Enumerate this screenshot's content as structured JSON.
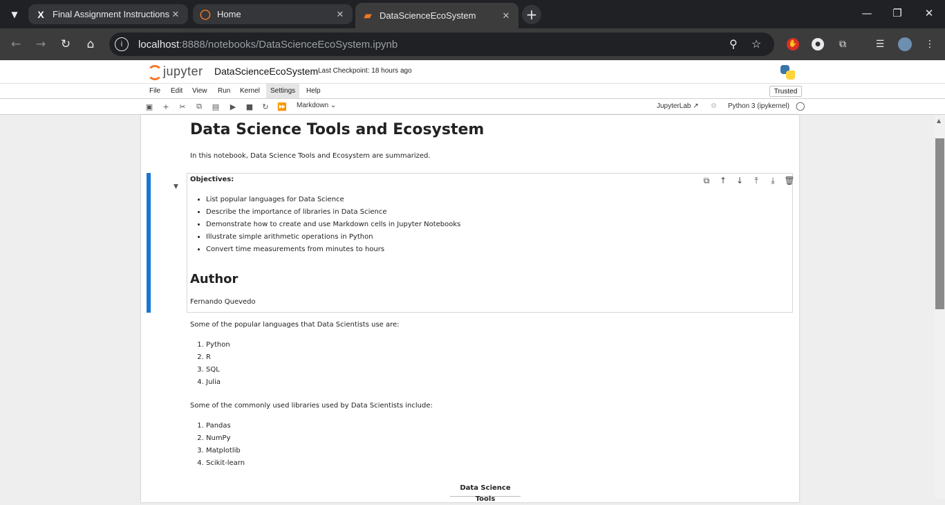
{
  "browser": {
    "tabs": [
      {
        "label": "Final Assignment Instructions: C",
        "icon": "x-logo-icon"
      },
      {
        "label": "Home",
        "icon": "jupyter-icon"
      },
      {
        "label": "DataScienceEcoSystem",
        "icon": "notebook-icon"
      }
    ],
    "url_host": "localhost",
    "url_rest": ":8888/notebooks/DataScienceEcoSystem.ipynb"
  },
  "jupyter": {
    "logo_text": "jupyter",
    "notebook_name": "DataScienceEcoSystem",
    "checkpoint": "Last Checkpoint: 18 hours ago",
    "menu": [
      "File",
      "Edit",
      "View",
      "Run",
      "Kernel",
      "Settings",
      "Help"
    ],
    "trusted": "Trusted",
    "cell_type": "Markdown",
    "jupyterlab_link": "JupyterLab",
    "kernel_name": "Python 3 (ipykernel)"
  },
  "notebook": {
    "title": "Data Science Tools and Ecosystem",
    "intro": "In this notebook, Data Science Tools and Ecosystem are summarized.",
    "objectives_heading": "Objectives:",
    "objectives": [
      "List popular languages for Data Science",
      "Describe the importance of libraries in Data Science",
      "Demonstrate how to create and use Markdown cells in Jupyter Notebooks",
      "Illustrate simple arithmetic operations in Python",
      "Convert time measurements from minutes to hours"
    ],
    "author_heading": "Author",
    "author_name": "Fernando Quevedo",
    "languages_intro": "Some of the popular languages that Data Scientists use are:",
    "languages": [
      "Python",
      "R",
      "SQL",
      "Julia"
    ],
    "libraries_intro": "Some of the commonly used libraries used by Data Scientists include:",
    "libraries": [
      "Pandas",
      "NumPy",
      "Matplotlib",
      "Scikit-learn"
    ],
    "table_header": "Data Science Tools"
  }
}
